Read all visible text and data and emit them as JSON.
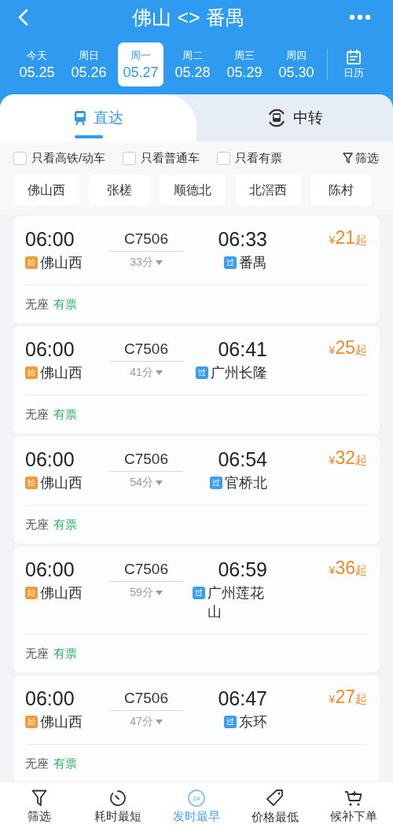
{
  "header": {
    "title": "佛山 <> 番禺"
  },
  "dates": [
    {
      "weekday": "今天",
      "date": "05.25",
      "selected": false
    },
    {
      "weekday": "周日",
      "date": "05.26",
      "selected": false
    },
    {
      "weekday": "周一",
      "date": "05.27",
      "selected": true
    },
    {
      "weekday": "周二",
      "date": "05.28",
      "selected": false
    },
    {
      "weekday": "周三",
      "date": "05.29",
      "selected": false
    },
    {
      "weekday": "周四",
      "date": "05.30",
      "selected": false
    }
  ],
  "calendar": {
    "label": "日历"
  },
  "tabs": [
    {
      "label": "直达",
      "kind": "direct",
      "selected": true
    },
    {
      "label": "中转",
      "kind": "transfer",
      "selected": false
    }
  ],
  "filters": [
    {
      "label": "只看高铁/动车",
      "checked": false
    },
    {
      "label": "只看普通车",
      "checked": false
    },
    {
      "label": "只看有票",
      "checked": false
    }
  ],
  "filter_button": {
    "label": "筛选"
  },
  "stations": [
    "佛山西",
    "张槎",
    "顺德北",
    "北滘西",
    "陈村"
  ],
  "trains": [
    {
      "depart_time": "06:00",
      "train_no": "C7506",
      "arrive_time": "06:33",
      "from_badge": "始",
      "from": "佛山西",
      "duration": "33分",
      "to_badge": "过",
      "to": "番禺",
      "currency": "¥",
      "price": "21",
      "price_suffix": "起",
      "seat": "无座",
      "availability": "有票"
    },
    {
      "depart_time": "06:00",
      "train_no": "C7506",
      "arrive_time": "06:41",
      "from_badge": "始",
      "from": "佛山西",
      "duration": "41分",
      "to_badge": "过",
      "to": "广州长隆",
      "currency": "¥",
      "price": "25",
      "price_suffix": "起",
      "seat": "无座",
      "availability": "有票"
    },
    {
      "depart_time": "06:00",
      "train_no": "C7506",
      "arrive_time": "06:54",
      "from_badge": "始",
      "from": "佛山西",
      "duration": "54分",
      "to_badge": "过",
      "to": "官桥北",
      "currency": "¥",
      "price": "32",
      "price_suffix": "起",
      "seat": "无座",
      "availability": "有票"
    },
    {
      "depart_time": "06:00",
      "train_no": "C7506",
      "arrive_time": "06:59",
      "from_badge": "始",
      "from": "佛山西",
      "duration": "59分",
      "to_badge": "过",
      "to": "广州莲花山",
      "currency": "¥",
      "price": "36",
      "price_suffix": "起",
      "seat": "无座",
      "availability": "有票"
    },
    {
      "depart_time": "06:00",
      "train_no": "C7506",
      "arrive_time": "06:47",
      "from_badge": "始",
      "from": "佛山西",
      "duration": "47分",
      "to_badge": "过",
      "to": "东环",
      "currency": "¥",
      "price": "27",
      "price_suffix": "起",
      "seat": "无座",
      "availability": "有票"
    }
  ],
  "bottom_bar": [
    {
      "label": "筛选",
      "kind": "filter",
      "selected": false
    },
    {
      "label": "耗时最短",
      "kind": "timer",
      "selected": false
    },
    {
      "label": "发时最早",
      "kind": "clock",
      "icon_text": "24",
      "selected": true
    },
    {
      "label": "价格最低",
      "kind": "tag",
      "selected": false
    },
    {
      "label": "候补下单",
      "kind": "cart",
      "selected": false
    }
  ]
}
